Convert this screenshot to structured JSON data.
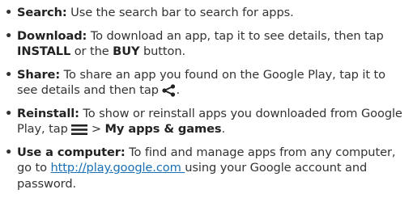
{
  "items": [
    {
      "title": "Search:",
      "text": " Use the search bar to search for apps."
    },
    {
      "title": "Download:",
      "text_1": " To download an app, tap it to see details, then tap ",
      "bold_1": "INSTALL",
      "text_2": " or the ",
      "bold_2": "BUY",
      "text_3": " button."
    },
    {
      "title": "Share:",
      "text_1": " To share an app you found on the Google Play, tap it to see details and then tap ",
      "icon": "share-icon",
      "text_2": "."
    },
    {
      "title": "Reinstall:",
      "text_1": " To show or reinstall apps you downloaded from Google Play, tap ",
      "icon": "menu-icon",
      "text_2": " > ",
      "bold_1": "My apps & games",
      "text_3": "."
    },
    {
      "title": "Use a computer:",
      "text_1": " To find and manage apps from any computer, go to ",
      "link": "http://play.google.com ",
      "text_2": "using your Google account and password."
    }
  ],
  "colors": {
    "text": "#333333",
    "link": "#1a6fb5"
  }
}
